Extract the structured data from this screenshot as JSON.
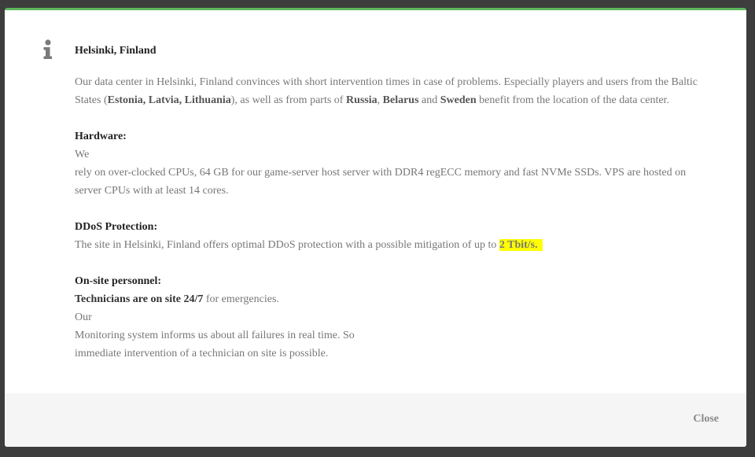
{
  "modal": {
    "icon": "info-icon",
    "accent_color": "#5cb85c",
    "title": "Helsinki, Finland",
    "intro": {
      "t1": "Our data center in Helsinki, Finland convinces with short intervention times in case of problems. Especially players and users from the Baltic States (",
      "b1": "Estonia, Latvia, Lithuania",
      "t2": "), as well as from parts of ",
      "b2": "Russia",
      "t3": ", ",
      "b3": "Belarus",
      "t4": " and ",
      "b4": "Sweden",
      "t5": " benefit from the location of the data center."
    },
    "hardware": {
      "heading": "Hardware:",
      "line1": "We",
      "line2": "rely on over-clocked CPUs, 64 GB for our game-server host server  with DDR4 regECC memory and fast NVMe SSDs. VPS are hosted on server CPUs with at least 14 cores."
    },
    "ddos": {
      "heading": "DDoS Protection:",
      "text": "The site in Helsinki, Finland offers optimal DDoS protection with a possible mitigation of up to ",
      "highlight": "2 Tbit/s."
    },
    "personnel": {
      "heading": "On-site personnel:",
      "bold": "Technicians are on site 24/7",
      "rest": " for emergencies.",
      "line2": "Our",
      "line3": "Monitoring system informs us about all failures in real time. So",
      "line4": "immediate intervention of a technician on site is possible."
    },
    "footer": {
      "close_label": "Close"
    }
  }
}
